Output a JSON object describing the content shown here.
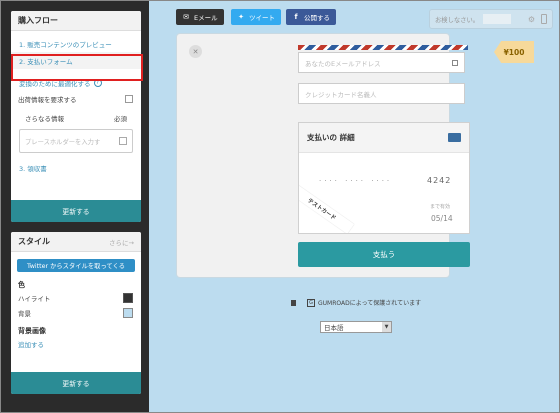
{
  "sidebar": {
    "flow": {
      "title": "購入フロー",
      "steps": [
        {
          "label": "1. 販売コンテンツのプレビュー"
        },
        {
          "label": "2. 支払いフォーム"
        }
      ],
      "optimize_link": "変換のために最適化する",
      "option_request_info": "出荷情報を要求する",
      "more_info_label": "さらなる情報",
      "more_info_required": "必須",
      "placeholder_field": "プレースホルダーを入力す",
      "step3": "3. 領収書",
      "update_button": "更新する"
    },
    "style": {
      "title": "スタイル",
      "more": "さらに→",
      "twitter_button": "Twitter からスタイルを取ってくる",
      "color_label": "色",
      "highlight_label": "ハイライト",
      "background_label": "背景",
      "bgimage_label": "背景画像",
      "add_link": "追加する",
      "update_button": "更新する"
    }
  },
  "share": {
    "email": "Eメール",
    "tweet": "ツイート",
    "facebook": "公開する"
  },
  "search_placeholder": "お検しなさい。",
  "checkout": {
    "price": "¥100",
    "email_placeholder": "あなたのEメールアドレス",
    "cardname_placeholder": "クレジットカード名義人",
    "detail_title": "支払いの 詳細",
    "card_dots": "···· ···· ····",
    "card_last4": "4242",
    "expiry_label": "まで有効",
    "expiry_value": "05/14",
    "test_ribbon": "テストカード",
    "pay_button": "支払う"
  },
  "footer": {
    "secured_text": "GUMROADによって保護されています",
    "language": "日本語"
  },
  "colors": {
    "teal": "#2b9aa1",
    "bg": "#bcdcef",
    "highlight_red": "#e02020"
  }
}
